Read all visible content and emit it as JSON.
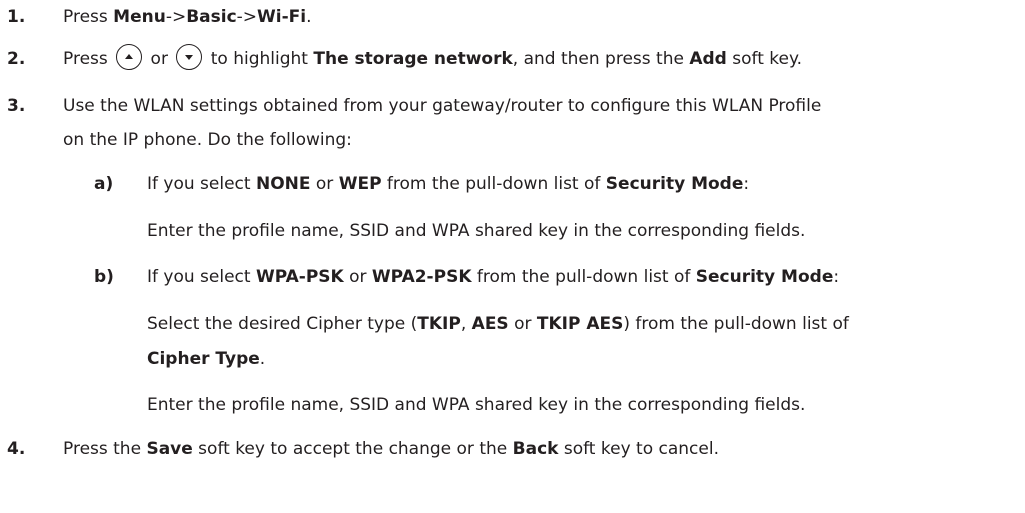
{
  "steps": [
    {
      "number": "1.",
      "parts": [
        "Press ",
        "Menu",
        "->",
        "Basic",
        "->",
        "Wi-Fi",
        "."
      ]
    },
    {
      "number": "2.",
      "parts": [
        "Press ",
        " or ",
        " to highlight ",
        "The storage network",
        ", and then press the ",
        "Add",
        " soft key."
      ]
    },
    {
      "number": "3.",
      "line1": "Use the WLAN settings obtained from your gateway/router to configure this WLAN Profile",
      "line2": "on the IP phone. Do the following:"
    },
    {
      "number": "4.",
      "parts": [
        "Press the ",
        "Save",
        " soft key to accept the change or the ",
        "Back",
        " soft key to cancel."
      ]
    }
  ],
  "substeps": [
    {
      "letter": "a)",
      "parts": [
        "If you select ",
        "NONE",
        " or ",
        "WEP",
        " from the pull-down list of ",
        "Security Mode",
        ":"
      ],
      "detail": "Enter the profile name, SSID and WPA shared key in the corresponding fields."
    },
    {
      "letter": "b)",
      "parts": [
        "If you select ",
        "WPA-PSK",
        " or ",
        "WPA2-PSK",
        " from the pull-down list of ",
        "Security Mode",
        ":"
      ],
      "detail1_parts": [
        "Select the desired Cipher type (",
        "TKIP",
        ", ",
        "AES",
        " or ",
        "TKIP AES",
        ") from the pull-down list of"
      ],
      "detail1_line2": "Cipher Type",
      "detail1_line2_end": ".",
      "detail2": "Enter the profile name, SSID and WPA shared key in the corresponding fields."
    }
  ],
  "icons": {
    "up_key": "up-arrow-key-icon",
    "down_key": "down-arrow-key-icon"
  },
  "colors": {
    "text": "#231f20"
  }
}
